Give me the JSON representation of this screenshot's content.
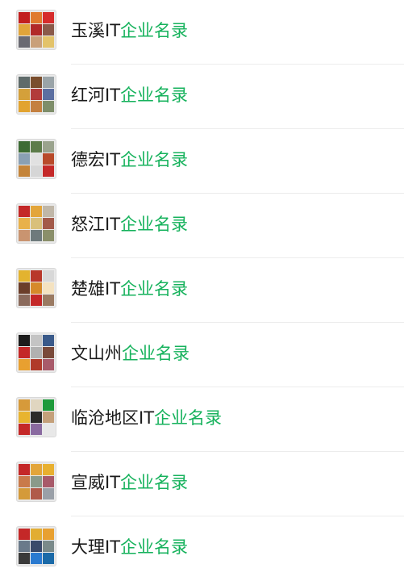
{
  "list": {
    "items": [
      {
        "prefix": "玉溪IT",
        "highlight": "企业名录",
        "avatar": [
          "#c21f1f",
          "#e07a2e",
          "#d62c2c",
          "#e1a53a",
          "#b12929",
          "#8a5a4a",
          "#6a6a72",
          "#c9a07a",
          "#e3c36a"
        ]
      },
      {
        "prefix": "红河IT",
        "highlight": "企业名录",
        "avatar": [
          "#5f6b6a",
          "#7a4e2e",
          "#9aa4a8",
          "#d4a03a",
          "#b23b3b",
          "#5c6fa1",
          "#e2a32f",
          "#c48040",
          "#7e8e6a"
        ]
      },
      {
        "prefix": "德宏IT",
        "highlight": "企业名录",
        "avatar": [
          "#3d6b34",
          "#5d7c4a",
          "#9aa38d",
          "#8aa0b4",
          "#e1e1e1",
          "#b84a2a",
          "#c4843a",
          "#d6d6d6",
          "#c42828"
        ]
      },
      {
        "prefix": "怒江IT",
        "highlight": "企业名录",
        "avatar": [
          "#c42828",
          "#e3a53a",
          "#c0b7a8",
          "#e8b14a",
          "#d9c07a",
          "#a35a4a",
          "#c99470",
          "#6e7a7c",
          "#8a8f6a"
        ]
      },
      {
        "prefix": "楚雄IT",
        "highlight": "企业名录",
        "avatar": [
          "#e3b32f",
          "#b8372a",
          "#d8d8d8",
          "#6b3e2a",
          "#d68a2a",
          "#f4e2c0",
          "#8a6a5c",
          "#c42828",
          "#9a7a62"
        ]
      },
      {
        "prefix": "文山州",
        "highlight": "企业名录",
        "avatar": [
          "#1c1c1c",
          "#c4c4c4",
          "#3a5a8a",
          "#c42828",
          "#b1b1b1",
          "#7a4a3a",
          "#e8a030",
          "#b03a2a",
          "#a85a6a"
        ]
      },
      {
        "prefix": "临沧地区IT",
        "highlight": "企业名录",
        "avatar": [
          "#d69a3a",
          "#e0d6c0",
          "#1e9a3a",
          "#e8b42f",
          "#2a2a2a",
          "#c4a07a",
          "#c42828",
          "#8a6aa0",
          "#e8e8e8"
        ]
      },
      {
        "prefix": "宣威IT",
        "highlight": "企业名录",
        "avatar": [
          "#c42828",
          "#e3a53a",
          "#e8b030",
          "#c97a4a",
          "#8a9a8a",
          "#a85a6a",
          "#d49a3a",
          "#b05a4a",
          "#9aa0a8"
        ]
      },
      {
        "prefix": "大理IT",
        "highlight": "企业名录",
        "avatar": [
          "#c42828",
          "#e2ad32",
          "#e8a030",
          "#6a7a8a",
          "#3a4a6a",
          "#7a8a8a",
          "#3a3a3a",
          "#2a7ad0",
          "#1a6aa8"
        ]
      }
    ]
  }
}
